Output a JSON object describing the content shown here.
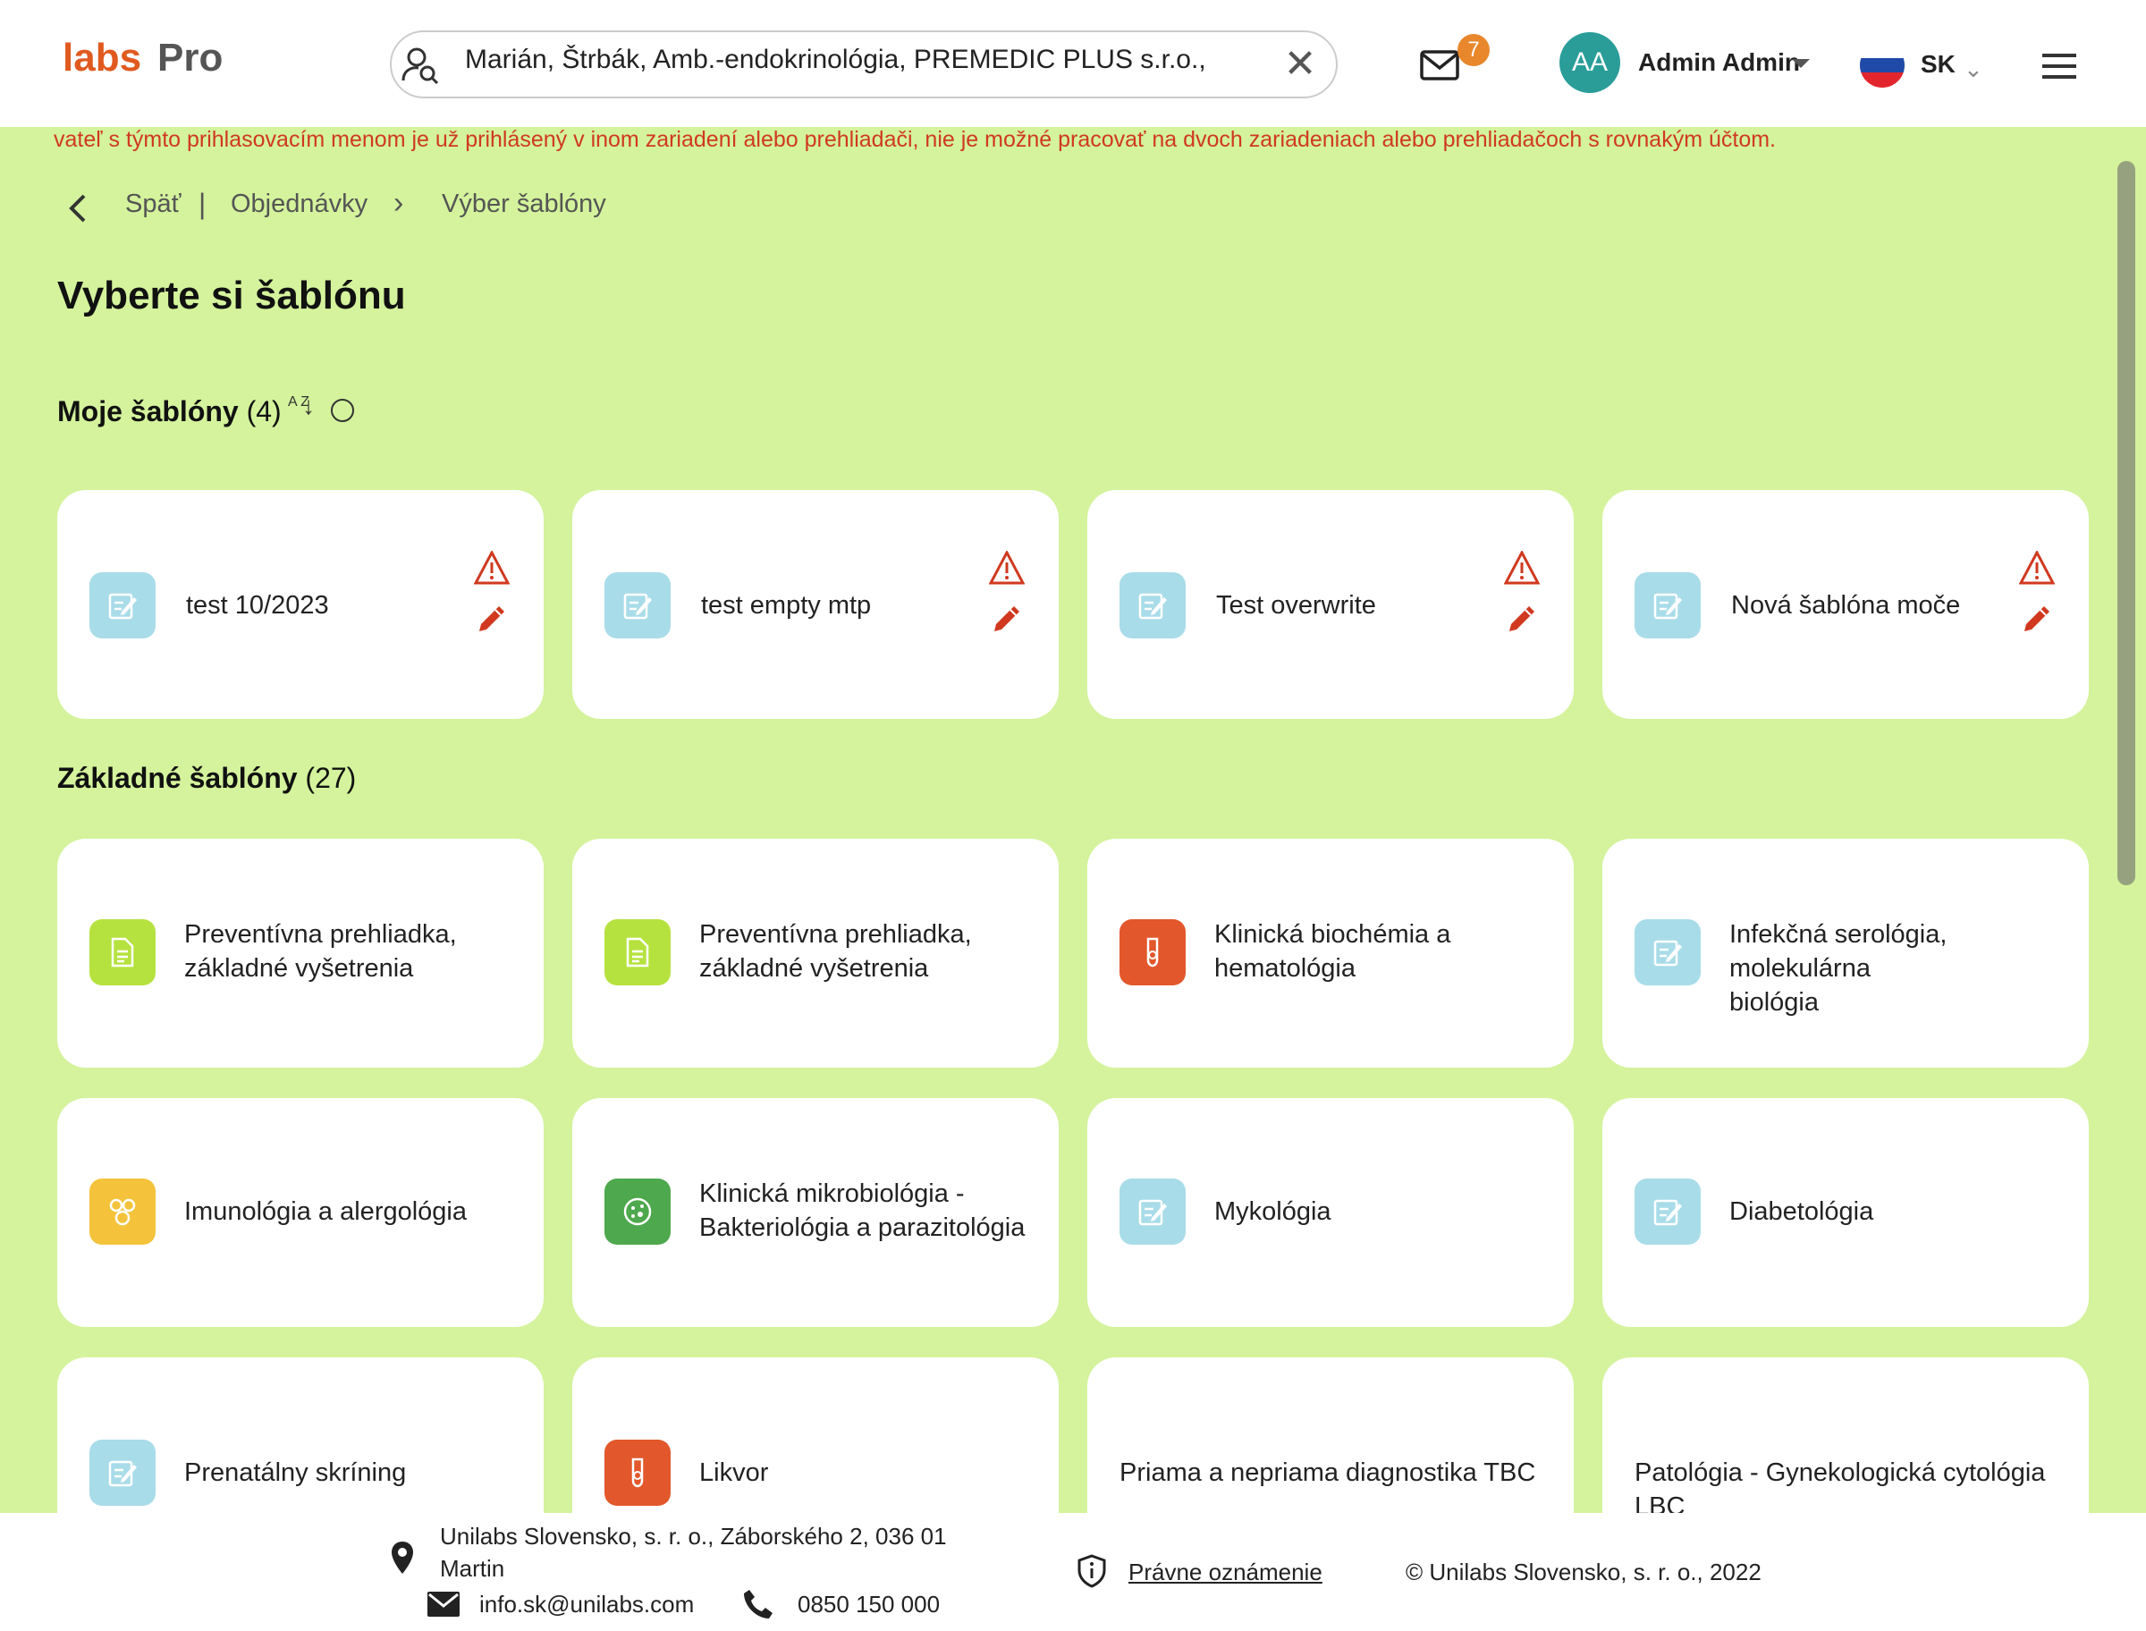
{
  "header": {
    "logo": "labs",
    "logo_suffix": "Pro",
    "search_value": "Marián, Štrbák, Amb.-endokrinológia, PREMEDIC PLUS s.r.o.,",
    "mail_badge": "7",
    "user_initials": "AA",
    "user_name": "Admin Admin",
    "language": "SK",
    "colors": {
      "accent": "#e05a1f",
      "avatar": "#2a9d99",
      "badge": "#e8872b"
    }
  },
  "warning": "vateľ s týmto prihlasovacím menom je už prihlásený v inom zariadení alebo prehliadači, nie je možné pracovať na dvoch zariadeniach alebo prehliadačoch s rovnakým účtom.",
  "breadcrumb": {
    "back": "Späť",
    "separator": "|",
    "orders": "Objednávky",
    "current": "Výber šablóny"
  },
  "page_title": "Vyberte si šablónu",
  "my_templates": {
    "title": "Moje šablóny",
    "count": "(4)",
    "sort_label": "A Z",
    "items": [
      {
        "label": "test 10/2023"
      },
      {
        "label": "test empty mtp"
      },
      {
        "label": "Test overwrite"
      },
      {
        "label": "Nová šablóna moče"
      }
    ]
  },
  "base_templates": {
    "title": "Základné šablóny",
    "count": "(27)",
    "items": [
      {
        "line1": "Preventívna prehliadka,",
        "line2": "základné vyšetrenia",
        "icon": "document-icon",
        "color": "#b6e23f"
      },
      {
        "line1": "Preventívna prehliadka,",
        "line2": "základné vyšetrenia",
        "icon": "document-icon",
        "color": "#b6e23f"
      },
      {
        "line1": "Klinická biochémia a",
        "line2": "hematológia",
        "icon": "test-tube-icon",
        "color": "#e2572b"
      },
      {
        "line1": "Infekčná serológia, molekulárna",
        "line2": "biológia",
        "icon": "edit-note-icon",
        "color": "#a8dce8"
      },
      {
        "line1": "Imunológia a alergológia",
        "line2": "",
        "icon": "cells-icon",
        "color": "#f4c33b"
      },
      {
        "line1": "Klinická mikrobiológia -",
        "line2": "Bakteriológia a parazitológia",
        "icon": "petri-dish-icon",
        "color": "#4ea84d"
      },
      {
        "line1": "Mykológia",
        "line2": "",
        "icon": "edit-note-icon",
        "color": "#a8dce8"
      },
      {
        "line1": "Diabetológia",
        "line2": "",
        "icon": "edit-note-icon",
        "color": "#a8dce8"
      },
      {
        "line1": "Prenatálny skríning",
        "line2": "",
        "icon": "edit-note-icon",
        "color": "#a8dce8"
      },
      {
        "line1": "Likvor",
        "line2": "",
        "icon": "test-tube-icon",
        "color": "#e2572b"
      },
      {
        "line1": "Priama a nepriama diagnostika TBC",
        "line2": "",
        "icon": "",
        "color": ""
      },
      {
        "line1": "Patológia - Gynekologická cytológia LBC",
        "line2": "",
        "icon": "",
        "color": ""
      }
    ]
  },
  "footer": {
    "address_line1": "Unilabs Slovensko, s. r. o., Záborského 2, 036 01",
    "address_line2": "Martin",
    "email": "info.sk@unilabs.com",
    "phone": "0850 150 000",
    "legal": "Právne oznámenie",
    "copyright": "© Unilabs Slovensko, s. r. o., 2022"
  }
}
